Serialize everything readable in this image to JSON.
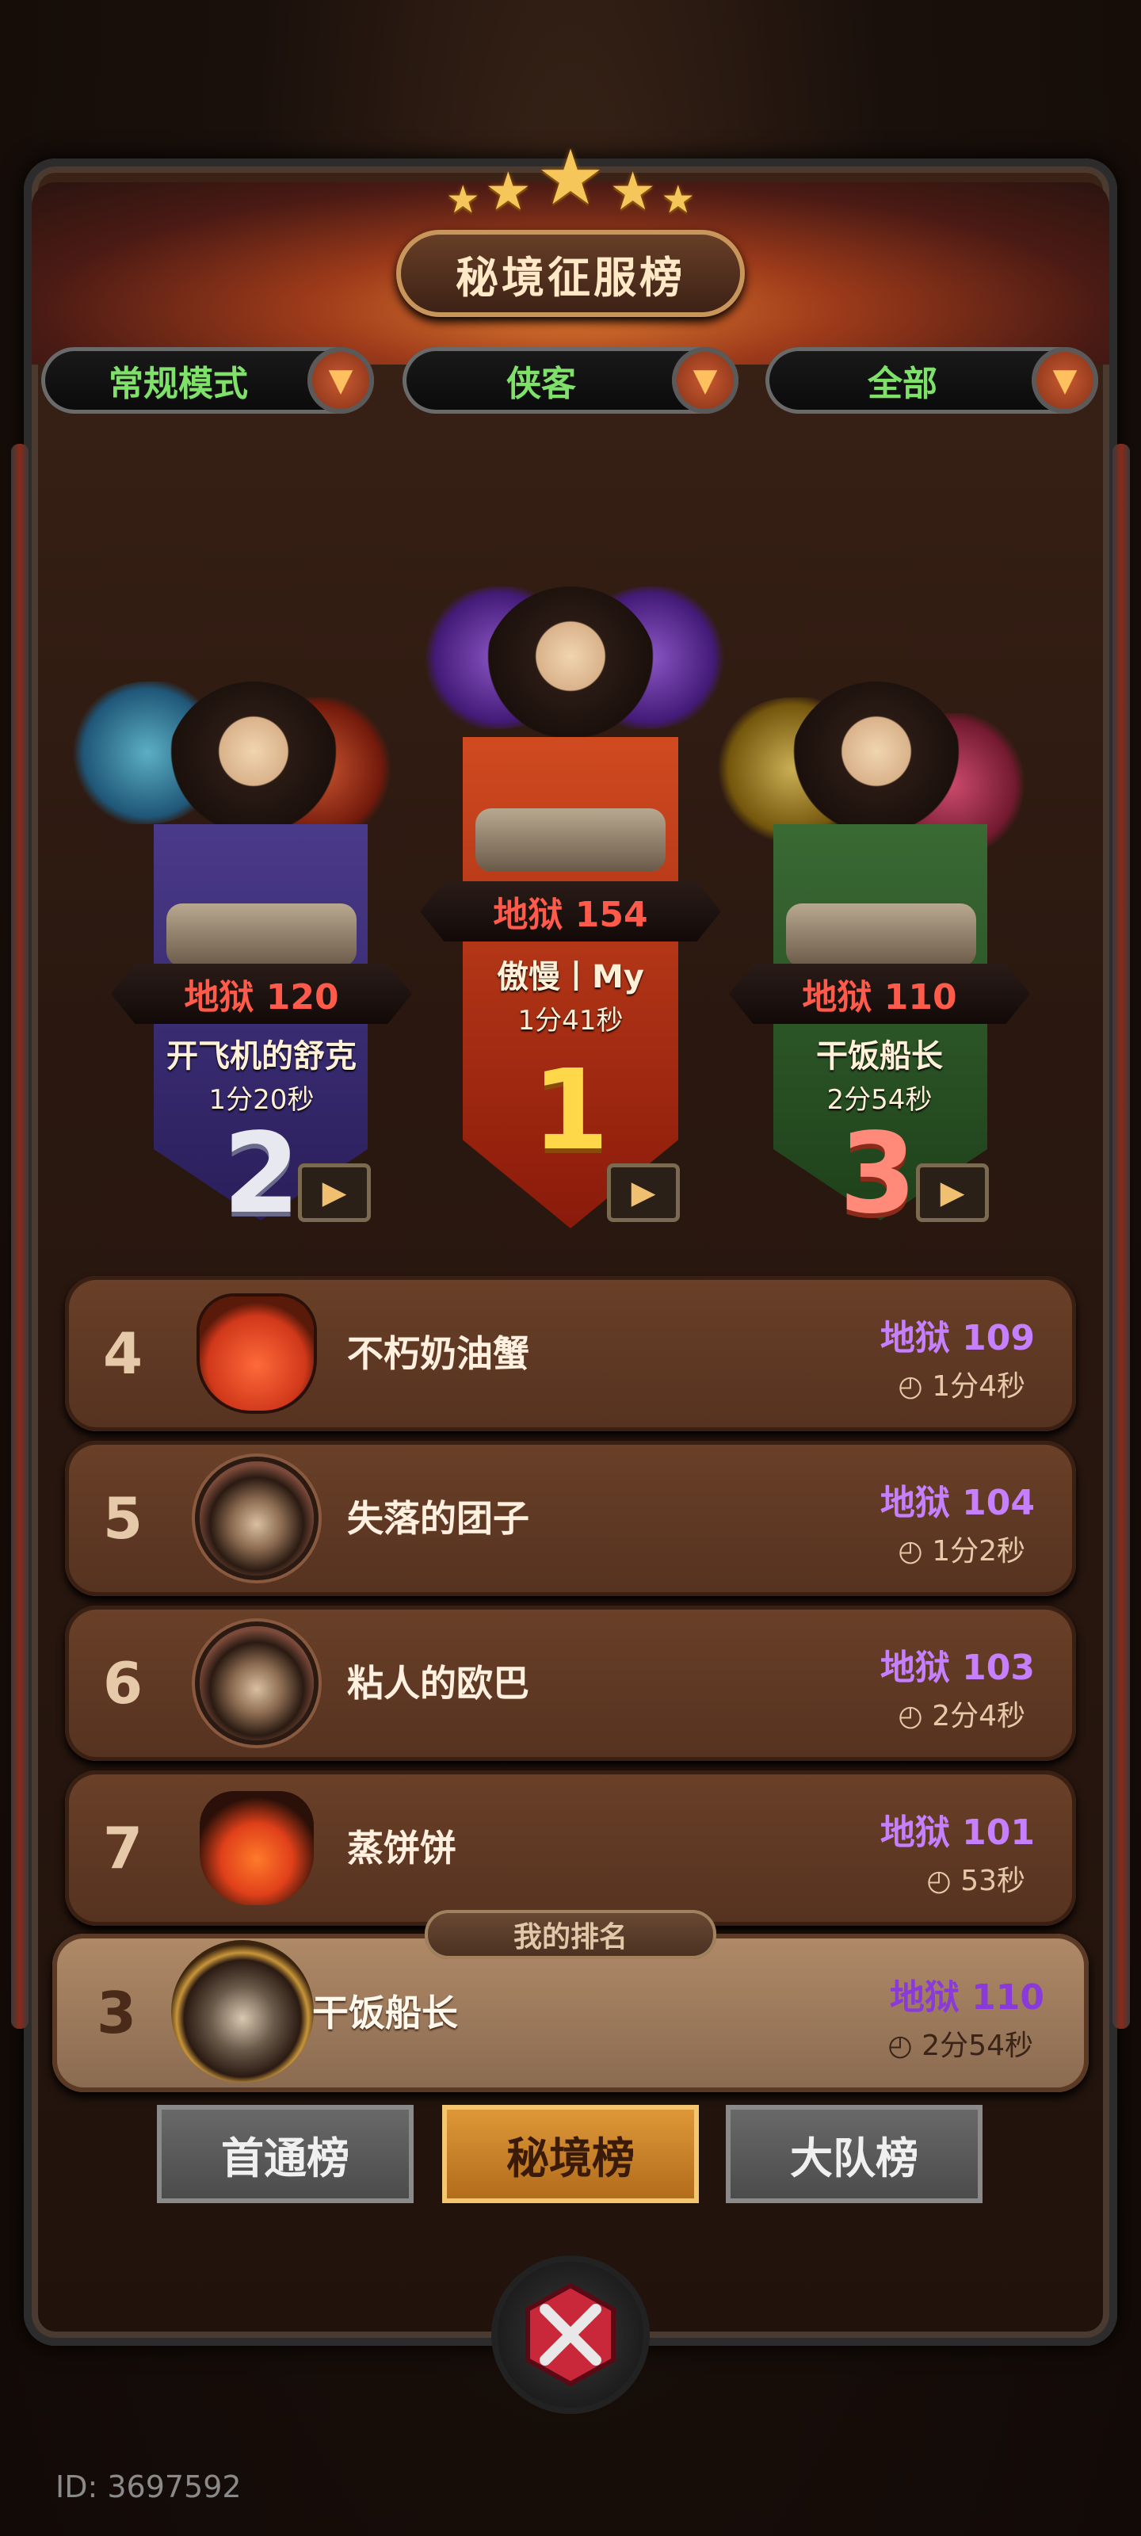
{
  "header": {
    "title": "秘境征服榜",
    "star_count": 5
  },
  "filters": [
    {
      "label": "常规模式"
    },
    {
      "label": "侠客"
    },
    {
      "label": "全部"
    }
  ],
  "podium": {
    "first": {
      "rank": "1",
      "level": "地狱 154",
      "name": "傲慢丨My",
      "time": "1分41秒"
    },
    "second": {
      "rank": "2",
      "level": "地狱 120",
      "name": "开飞机的舒克",
      "time": "1分20秒"
    },
    "third": {
      "rank": "3",
      "level": "地狱 110",
      "name": "干饭船长",
      "time": "2分54秒"
    }
  },
  "list": [
    {
      "rank": "4",
      "name": "不朽奶油蟹",
      "level": "地狱 109",
      "time": "1分4秒",
      "avatar": "crab"
    },
    {
      "rank": "5",
      "name": "失落的团子",
      "level": "地狱 104",
      "time": "1分2秒",
      "avatar": "hat"
    },
    {
      "rank": "6",
      "name": "粘人的欧巴",
      "level": "地狱 103",
      "time": "2分4秒",
      "avatar": "hat"
    },
    {
      "rank": "7",
      "name": "蒸饼饼",
      "level": "地狱 101",
      "time": "53秒",
      "avatar": "blob"
    }
  ],
  "my_rank": {
    "tag": "我的排名",
    "rank": "3",
    "name": "干饭船长",
    "level": "地狱 110",
    "time": "2分54秒"
  },
  "tabs": [
    {
      "label": "首通榜",
      "active": false
    },
    {
      "label": "秘境榜",
      "active": true
    },
    {
      "label": "大队榜",
      "active": false
    }
  ],
  "icons": {
    "filter_arrow": "chevron-down-icon",
    "video": "video-camera-icon",
    "clock": "clock-icon",
    "close": "close-icon",
    "star": "star-icon"
  },
  "colors": {
    "level_text": "#c680ff",
    "podium_level_text": "#ff5a4a",
    "filter_text": "#7fe06a",
    "active_tab": "#e09a3a"
  },
  "footer": {
    "user_id": "ID: 3697592"
  }
}
